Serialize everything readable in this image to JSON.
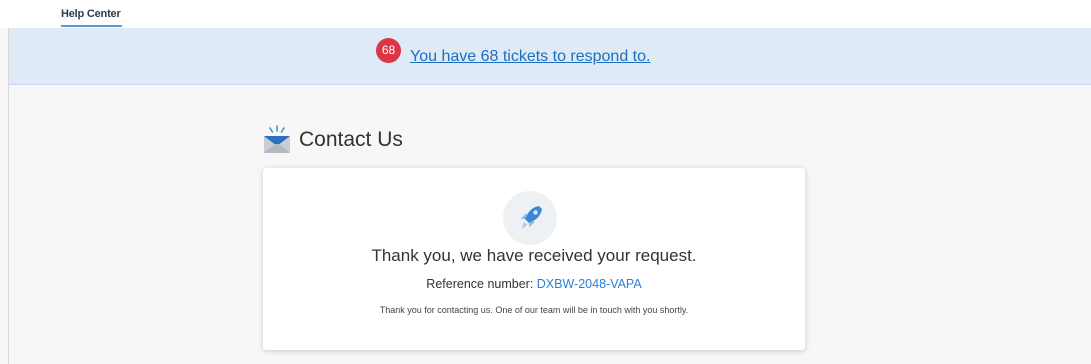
{
  "nav": {
    "tab_label": "Help Center"
  },
  "banner": {
    "badge_count": "68",
    "link_text": "You have 68 tickets to respond to."
  },
  "page": {
    "title": "Contact Us"
  },
  "confirmation": {
    "message": "Thank you, we have received your request.",
    "reference_label": "Reference number: ",
    "reference_number": "DXBW-2048-VAPA",
    "note": "Thank you for contacting us. One of our team will be in touch with you shortly."
  },
  "colors": {
    "accent": "#2d7fd3",
    "badge": "#dc3545",
    "banner_bg": "#deeaf6"
  },
  "icons": {
    "heading": "envelope-icon",
    "card": "rocket-icon"
  }
}
